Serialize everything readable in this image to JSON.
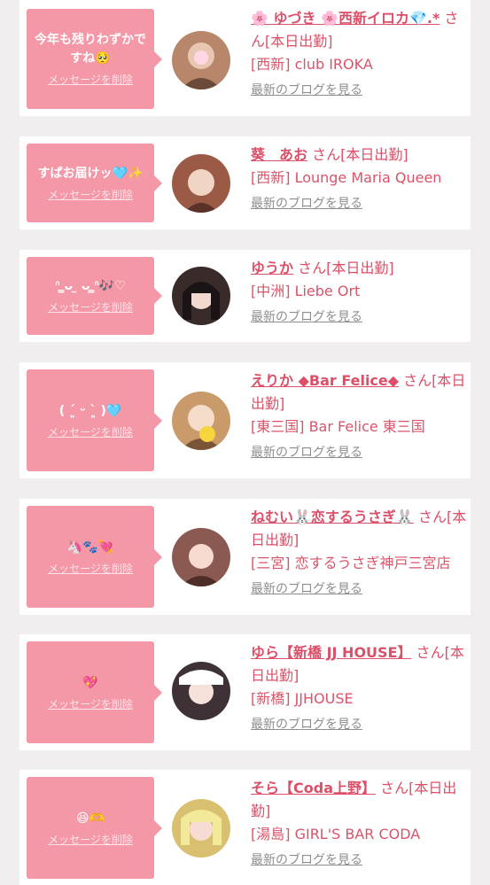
{
  "entries": [
    {
      "message": "今年も残りわずかですね🥺",
      "delete": "メッセージを削除",
      "name": "🌸 ゆづき 🌸西新イロカ💎.*",
      "suffix": " さん[本日出勤]",
      "shop": "[西新] club IROKA",
      "blog": "最新のブログを見る",
      "avatar_color": "#b8866a"
    },
    {
      "message": "すぱお届けッ🩵✨",
      "delete": "メッセージを削除",
      "name": "葵　あお",
      "suffix": " さん[本日出勤]",
      "shop": "[西新] Lounge Maria Queen",
      "blog": "最新のブログを見る",
      "avatar_color": "#9a5a46"
    },
    {
      "message": "ᐢ ̳ᴗ ̫ ᴗ ̳ᐢ🎶♡",
      "delete": "メッセージを削除",
      "name": "ゆうか",
      "suffix": " さん[本日出勤]",
      "shop": "[中洲] Liebe Ort",
      "blog": "最新のブログを見る",
      "avatar_color": "#3a2b2b"
    },
    {
      "message": "( ´͈ ᵕ `͈ )🩵",
      "delete": "メッセージを削除",
      "name": "えりか ◆Bar Felice◆",
      "suffix": " さん[本日出勤]",
      "shop": "[東三国] Bar Felice 東三国",
      "blog": "最新のブログを見る",
      "avatar_color": "#c99a6a"
    },
    {
      "message": "🦄🐾💘",
      "delete": "メッセージを削除",
      "name": "ねむい🐰恋するうさぎ🐰",
      "suffix": " さん[本日出勤]",
      "shop": "[三宮] 恋するうさぎ神戸三宮店",
      "blog": "最新のブログを見る",
      "avatar_color": "#8a5a52"
    },
    {
      "message": "💖",
      "delete": "メッセージを削除",
      "name": "ゆら【新橋 JJ HOUSE】",
      "suffix": " さん[本日出勤]",
      "shop": "[新橋] JJHOUSE",
      "blog": "最新のブログを見る",
      "avatar_color": "#3e3236"
    },
    {
      "message": "😆🫶",
      "delete": "メッセージを削除",
      "name": "そら【Coda上野】",
      "suffix": " さん[本日出勤]",
      "shop": "[湯島] GIRL'S BAR CODA",
      "blog": "最新のブログを見る",
      "avatar_color": "#d9c070"
    }
  ]
}
